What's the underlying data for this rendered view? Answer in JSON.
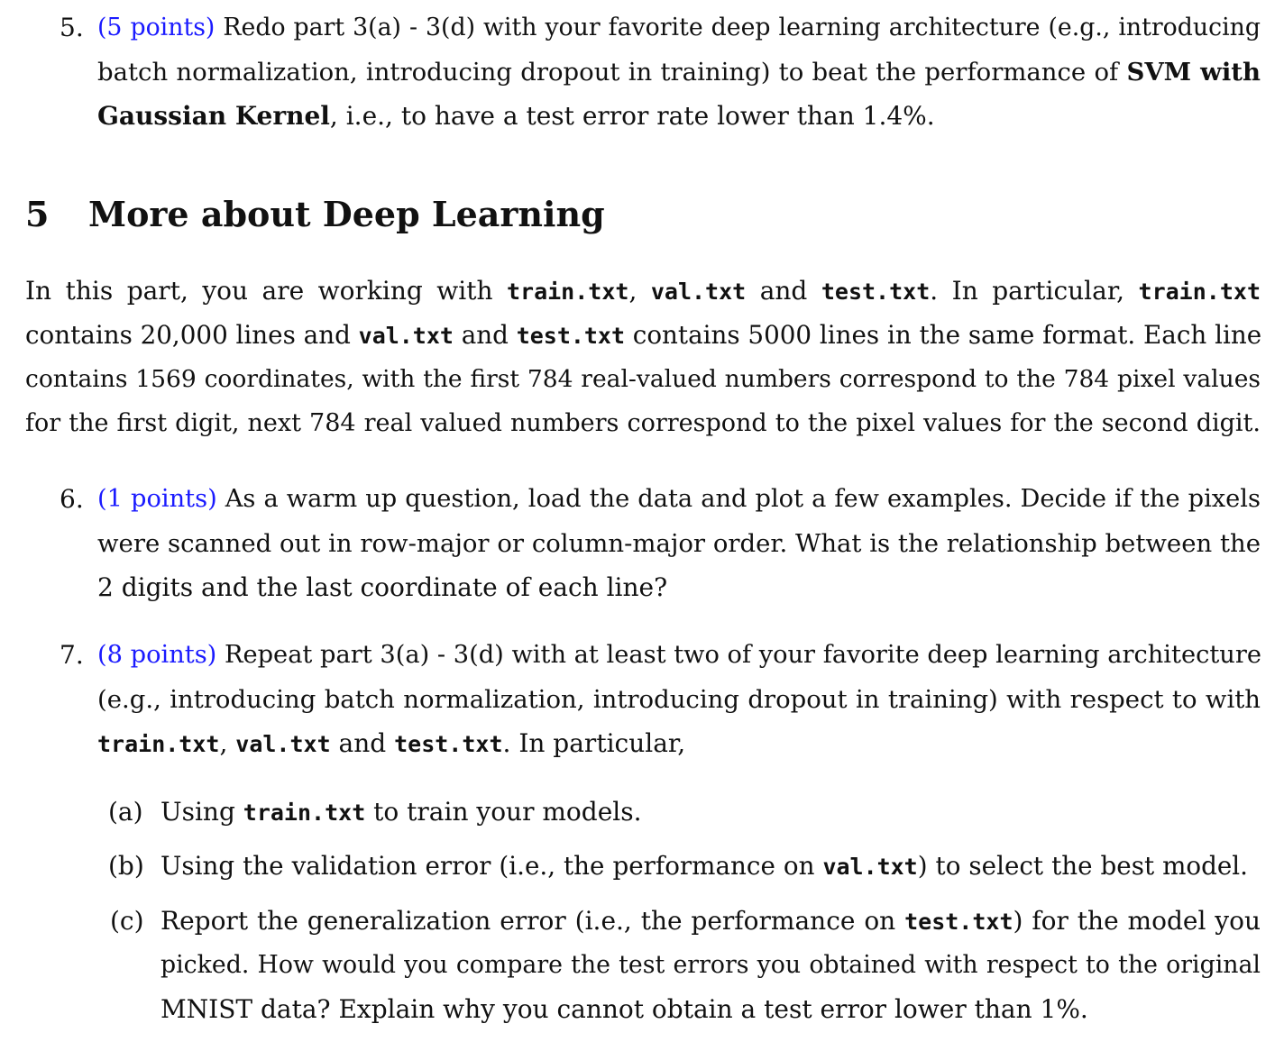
{
  "item5": {
    "num": "5.",
    "points": "(5 points)",
    "l1": " Redo part 3(a) - 3(d) with your favorite deep learning architecture (e.g., introducing",
    "l2a": "batch normalization, introducing dropout in training) to beat the performance of ",
    "l2b": "SVM with",
    "l3a": "Gaussian Kernel",
    "l3b": ", i.e., to have a test error rate lower than 1.4%."
  },
  "section": {
    "number": "5",
    "title": "More about Deep Learning"
  },
  "intro": {
    "l1a": "In this part, you are working with ",
    "train": "train.txt",
    "c1": ", ",
    "val": "val.txt",
    "and": " and ",
    "test": "test.txt",
    "l1b": ". In particular, ",
    "l2a": "contains 20,000 lines and ",
    "l2b": " contains 5000 lines in the same format. Each line",
    "l3": "contains 1569 coordinates, with the first 784 real-valued numbers correspond to the 784 pixel values",
    "l4": "for the first digit, next 784 real valued numbers correspond to the pixel values for the second digit."
  },
  "item6": {
    "num": "6.",
    "points": "(1 points)",
    "l1": " As a warm up question, load the data and plot a few examples. Decide if the pixels",
    "l2": "were scanned out in row-major or column-major order. What is the relationship between the",
    "l3": "2 digits and the last coordinate of each line?"
  },
  "item7": {
    "num": "7.",
    "points": "(8 points)",
    "l1": " Repeat part 3(a) - 3(d) with at least two of your favorite deep learning architecture",
    "l2": "(e.g., introducing batch normalization, introducing dropout in training) with respect to with",
    "l3b": ". In particular,"
  },
  "subitems": {
    "a_label": "(a)",
    "a1": "Using ",
    "a2": " to train your models.",
    "b_label": "(b)",
    "b1": "Using the validation error (i.e., the performance on ",
    "b2": ") to select the best model.",
    "c_label": "(c)",
    "c1": "Report the generalization error (i.e., the performance on ",
    "c2": ") for the model you",
    "c3": "picked. How would you compare the test errors you obtained with respect to the original",
    "c4": "MNIST data? Explain why you cannot obtain a test error lower than 1%."
  }
}
